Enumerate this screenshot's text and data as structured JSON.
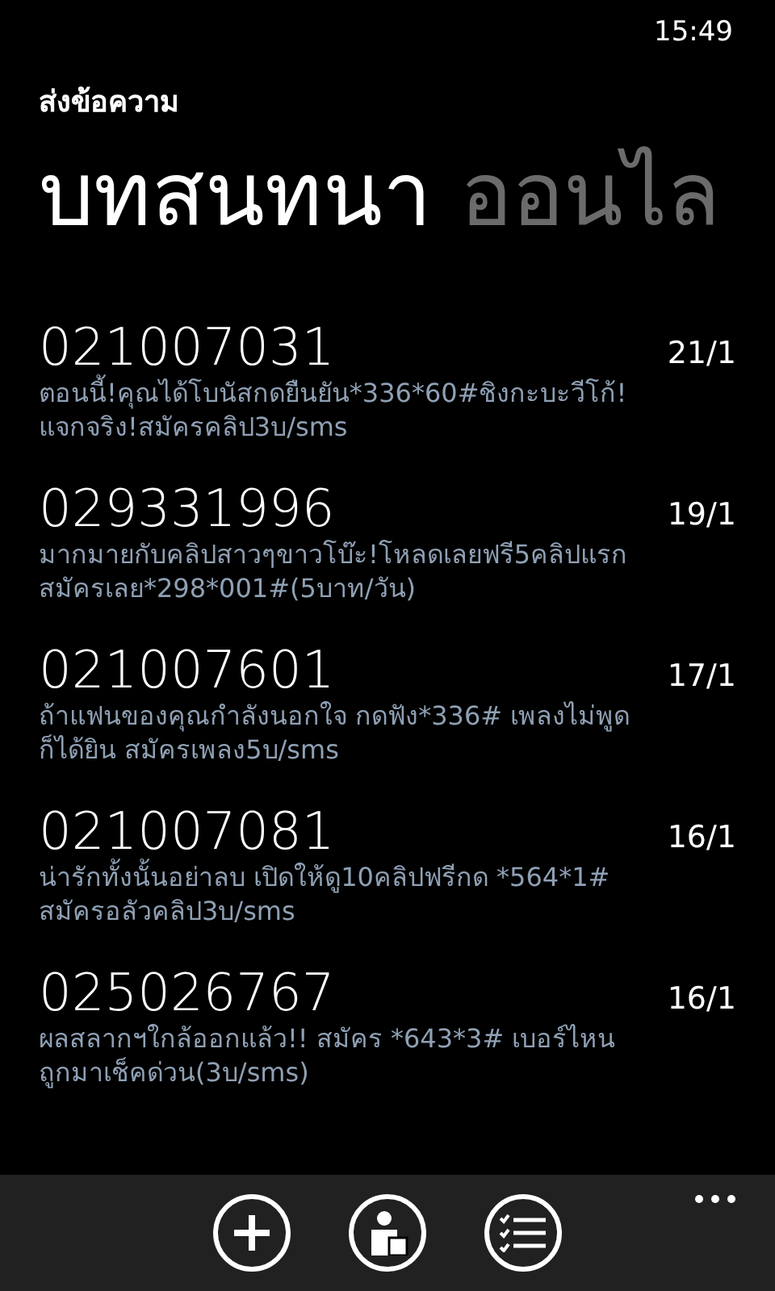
{
  "status_bar": {
    "time": "15:49"
  },
  "app_title": "ส่งข้อความ",
  "pivot": [
    {
      "label": "บทสนทนา",
      "selected": true
    },
    {
      "label": "ออนไล",
      "selected": false
    }
  ],
  "conversations": [
    {
      "sender": "021007031",
      "date": "21/1",
      "preview": "ตอนนี้!คุณได้โบนัสกดยืนยัน*336*60#ชิงกะบะวีโก้!แจกจริง!สมัครคลิป3บ/sms"
    },
    {
      "sender": "029331996",
      "date": "19/1",
      "preview": "มากมายกับคลิปสาวๆขาวโบ๊ะ!โหลดเลยฟรี5คลิปแรกสมัครเลย*298*001#(5บาท/วัน)"
    },
    {
      "sender": "021007601",
      "date": "17/1",
      "preview": "ถ้าแฟนของคุณกำลังนอกใจ กดฟัง*336# เพลงไม่พูดก็ได้ยิน สมัครเพลง5บ/sms"
    },
    {
      "sender": "021007081",
      "date": "16/1",
      "preview": "น่ารักทั้งนั้นอย่าลบ เปิดให้ดู10คลิปฟรีกด *564*1# สมัครอลัวคลิป3บ/sms"
    },
    {
      "sender": "025026767",
      "date": "16/1",
      "preview": "ผลสลากฯใกล้ออกแล้ว!! สมัคร *643*3# เบอร์ไหนถูกมาเช็คด่วน(3บ/sms)"
    }
  ],
  "app_bar": {
    "buttons": [
      {
        "kind": "new"
      },
      {
        "kind": "contact"
      },
      {
        "kind": "select"
      }
    ]
  }
}
